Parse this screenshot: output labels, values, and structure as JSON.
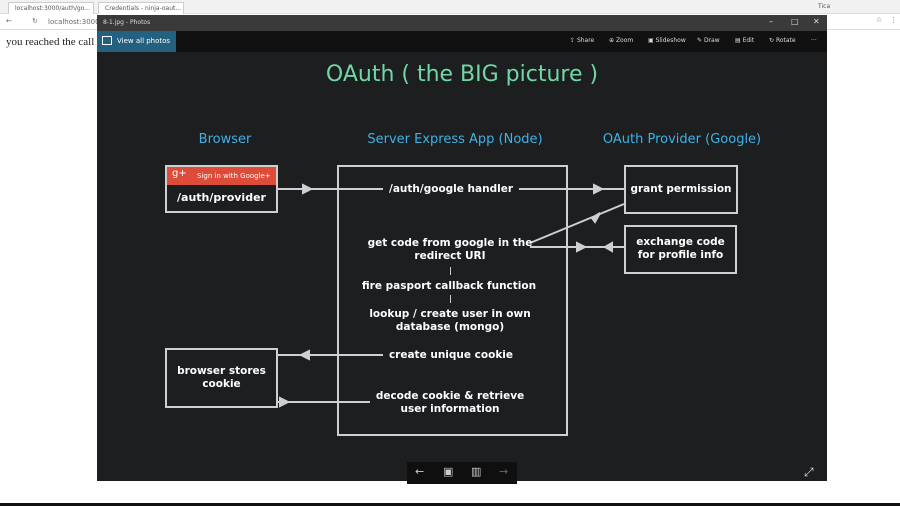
{
  "browser": {
    "tabs": [
      {
        "label": "localhost:3000/auth/go..."
      },
      {
        "label": "Credentials - ninja-oaut..."
      }
    ],
    "address": "localhost:3000",
    "user": "Tica",
    "page_text": "you reached the call"
  },
  "photos": {
    "title": "8-1.jpg - Photos",
    "view_all": "View all photos",
    "toolbar": [
      "Share",
      "Zoom",
      "Slideshow",
      "Draw",
      "Edit",
      "Rotate"
    ],
    "more": "···"
  },
  "slide": {
    "title": "OAuth ( the BIG picture )",
    "headers": {
      "browser": "Browser",
      "server": "Server Express App (Node)",
      "provider": "OAuth Provider (Google)"
    },
    "google_button": "Sign in with Google+",
    "google_logo": "g+",
    "auth_provider": "/auth/provider",
    "handler": "/auth/google handler",
    "get_code": "get code from google in the redirect URI",
    "fire": "fire pasport callback function",
    "lookup": "lookup / create user in own database (mongo)",
    "create_cookie": "create unique cookie",
    "decode": "decode cookie & retrieve user information",
    "grant": "grant permission",
    "exchange": "exchange code for profile info",
    "browser_stores": "browser stores cookie",
    "title_color": "#6fd8a4",
    "header_color": "#3fb2e6"
  }
}
